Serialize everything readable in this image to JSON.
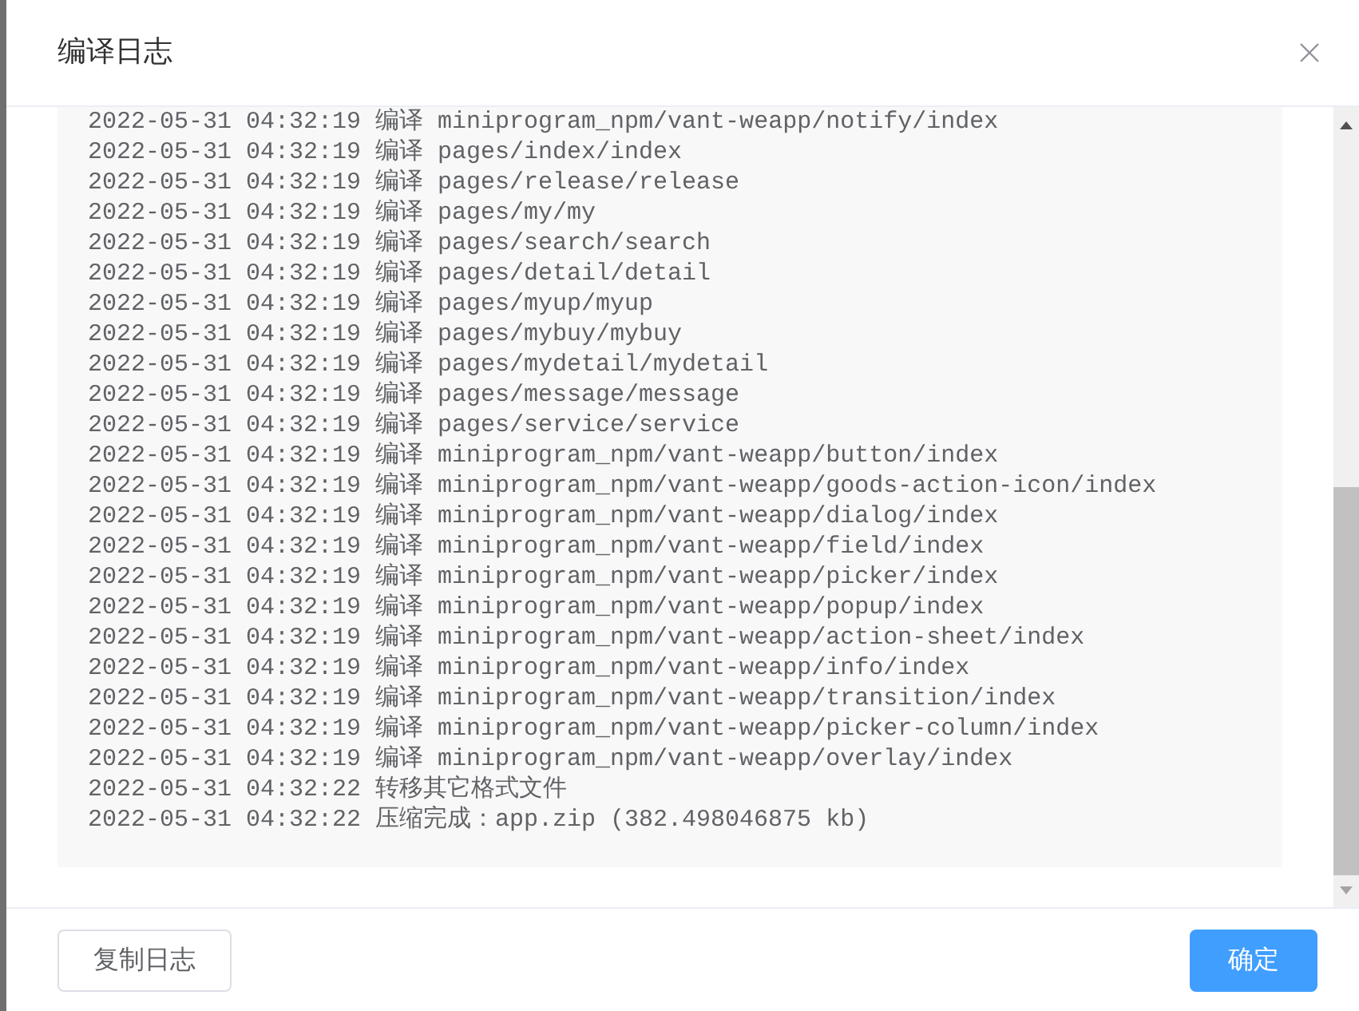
{
  "dialog": {
    "title": "编译日志"
  },
  "log": {
    "lines": [
      "2022-05-31 04:32:19 编译 miniprogram_npm/vant-weapp/notify/index",
      "2022-05-31 04:32:19 编译 pages/index/index",
      "2022-05-31 04:32:19 编译 pages/release/release",
      "2022-05-31 04:32:19 编译 pages/my/my",
      "2022-05-31 04:32:19 编译 pages/search/search",
      "2022-05-31 04:32:19 编译 pages/detail/detail",
      "2022-05-31 04:32:19 编译 pages/myup/myup",
      "2022-05-31 04:32:19 编译 pages/mybuy/mybuy",
      "2022-05-31 04:32:19 编译 pages/mydetail/mydetail",
      "2022-05-31 04:32:19 编译 pages/message/message",
      "2022-05-31 04:32:19 编译 pages/service/service",
      "2022-05-31 04:32:19 编译 miniprogram_npm/vant-weapp/button/index",
      "2022-05-31 04:32:19 编译 miniprogram_npm/vant-weapp/goods-action-icon/index",
      "2022-05-31 04:32:19 编译 miniprogram_npm/vant-weapp/dialog/index",
      "2022-05-31 04:32:19 编译 miniprogram_npm/vant-weapp/field/index",
      "2022-05-31 04:32:19 编译 miniprogram_npm/vant-weapp/picker/index",
      "2022-05-31 04:32:19 编译 miniprogram_npm/vant-weapp/popup/index",
      "2022-05-31 04:32:19 编译 miniprogram_npm/vant-weapp/action-sheet/index",
      "2022-05-31 04:32:19 编译 miniprogram_npm/vant-weapp/info/index",
      "2022-05-31 04:32:19 编译 miniprogram_npm/vant-weapp/transition/index",
      "2022-05-31 04:32:19 编译 miniprogram_npm/vant-weapp/picker-column/index",
      "2022-05-31 04:32:19 编译 miniprogram_npm/vant-weapp/overlay/index",
      "2022-05-31 04:32:22 转移其它格式文件",
      "2022-05-31 04:32:22 压缩完成：app.zip (382.498046875 kb)"
    ]
  },
  "footer": {
    "buttons": [
      {
        "label": "复制日志",
        "kind": "default"
      },
      {
        "label": "确定",
        "kind": "primary"
      }
    ]
  }
}
